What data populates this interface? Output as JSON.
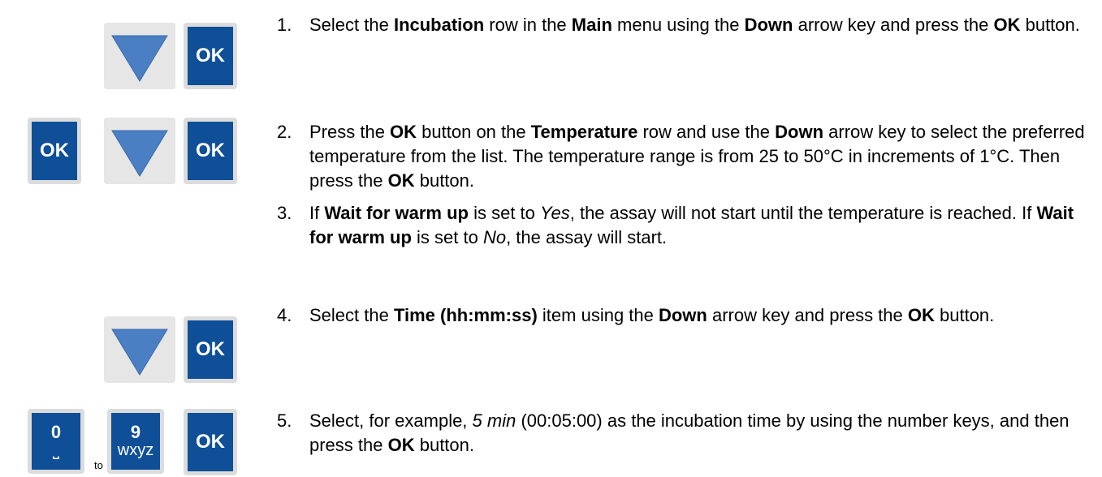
{
  "keys": {
    "ok": "OK",
    "zero_digit": "0",
    "zero_sub": "⎵",
    "nine_digit": "9",
    "nine_sub": "wxyz",
    "to": "to"
  },
  "steps": [
    {
      "num": "1.",
      "parts": [
        {
          "t": "Select the ",
          "s": "n"
        },
        {
          "t": "Incubation",
          "s": "b"
        },
        {
          "t": " row in the ",
          "s": "n"
        },
        {
          "t": "Main",
          "s": "b"
        },
        {
          "t": " menu using the ",
          "s": "n"
        },
        {
          "t": "Down",
          "s": "b"
        },
        {
          "t": " arrow key and press the ",
          "s": "n"
        },
        {
          "t": "OK",
          "s": "b"
        },
        {
          "t": " button.",
          "s": "n"
        }
      ]
    },
    {
      "num": "2.",
      "parts": [
        {
          "t": "Press the ",
          "s": "n"
        },
        {
          "t": "OK",
          "s": "b"
        },
        {
          "t": " button on the ",
          "s": "n"
        },
        {
          "t": "Temperature",
          "s": "b"
        },
        {
          "t": " row and use the ",
          "s": "n"
        },
        {
          "t": "Down",
          "s": "b"
        },
        {
          "t": " arrow key to select the preferred temperature from the list. The temperature range is from 25 to 50°C in increments of 1°C. Then press the ",
          "s": "n"
        },
        {
          "t": "OK",
          "s": "b"
        },
        {
          "t": " button.",
          "s": "n"
        }
      ]
    },
    {
      "num": "3.",
      "parts": [
        {
          "t": "If ",
          "s": "n"
        },
        {
          "t": "Wait for warm up",
          "s": "b"
        },
        {
          "t": " is set to ",
          "s": "n"
        },
        {
          "t": "Yes",
          "s": "i"
        },
        {
          "t": ", the assay will not start until the temperature is reached. If ",
          "s": "n"
        },
        {
          "t": "Wait for warm up",
          "s": "b"
        },
        {
          "t": " is set to ",
          "s": "n"
        },
        {
          "t": "No",
          "s": "i"
        },
        {
          "t": ", the assay will start.",
          "s": "n"
        }
      ]
    },
    {
      "num": "4.",
      "parts": [
        {
          "t": "Select the ",
          "s": "n"
        },
        {
          "t": "Time (hh:mm:ss)",
          "s": "b"
        },
        {
          "t": " item using the ",
          "s": "n"
        },
        {
          "t": "Down",
          "s": "b"
        },
        {
          "t": " arrow key and press the ",
          "s": "n"
        },
        {
          "t": "OK",
          "s": "b"
        },
        {
          "t": " button.",
          "s": "n"
        }
      ]
    },
    {
      "num": "5.",
      "parts": [
        {
          "t": "Select, for example, ",
          "s": "n"
        },
        {
          "t": "5 min",
          "s": "i"
        },
        {
          "t": " (00:05:00) as the incubation time by using the number keys, and then press the ",
          "s": "n"
        },
        {
          "t": "OK",
          "s": "b"
        },
        {
          "t": " button.",
          "s": "n"
        }
      ]
    }
  ]
}
